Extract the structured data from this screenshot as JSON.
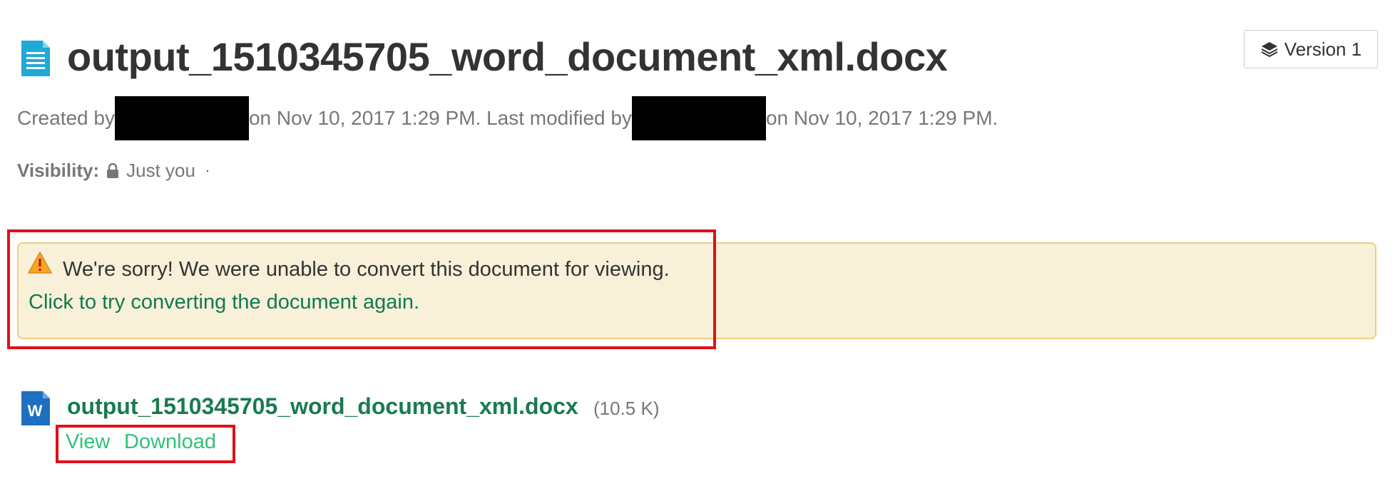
{
  "header": {
    "title": "output_1510345705_word_document_xml.docx",
    "title_icon": "document-icon",
    "version_label": "Version 1",
    "version_icon": "layers-icon"
  },
  "meta": {
    "created_prefix": "Created by",
    "created_suffix": "on Nov 10, 2017 1:29 PM. Last modified by",
    "modified_suffix": "on Nov 10, 2017 1:29 PM."
  },
  "visibility": {
    "label": "Visibility:",
    "value": "Just you",
    "icon": "lock-icon"
  },
  "alert": {
    "icon": "warning-icon",
    "message": "We're sorry! We were unable to convert this document for viewing.",
    "retry_link": "Click to try converting the document again."
  },
  "attachment": {
    "icon": "word-icon",
    "icon_letter": "W",
    "name": "output_1510345705_word_document_xml.docx",
    "size": "(10.5 K)",
    "view_label": "View",
    "download_label": "Download"
  },
  "colors": {
    "title_icon": "#1fa9d6",
    "link_green": "#0f7a4e",
    "action_green": "#2ec27a",
    "alert_bg": "#f8f0d9",
    "alert_border": "#f2cc80",
    "highlight_red": "#e0101a",
    "word_blue": "#1e6fc1"
  }
}
